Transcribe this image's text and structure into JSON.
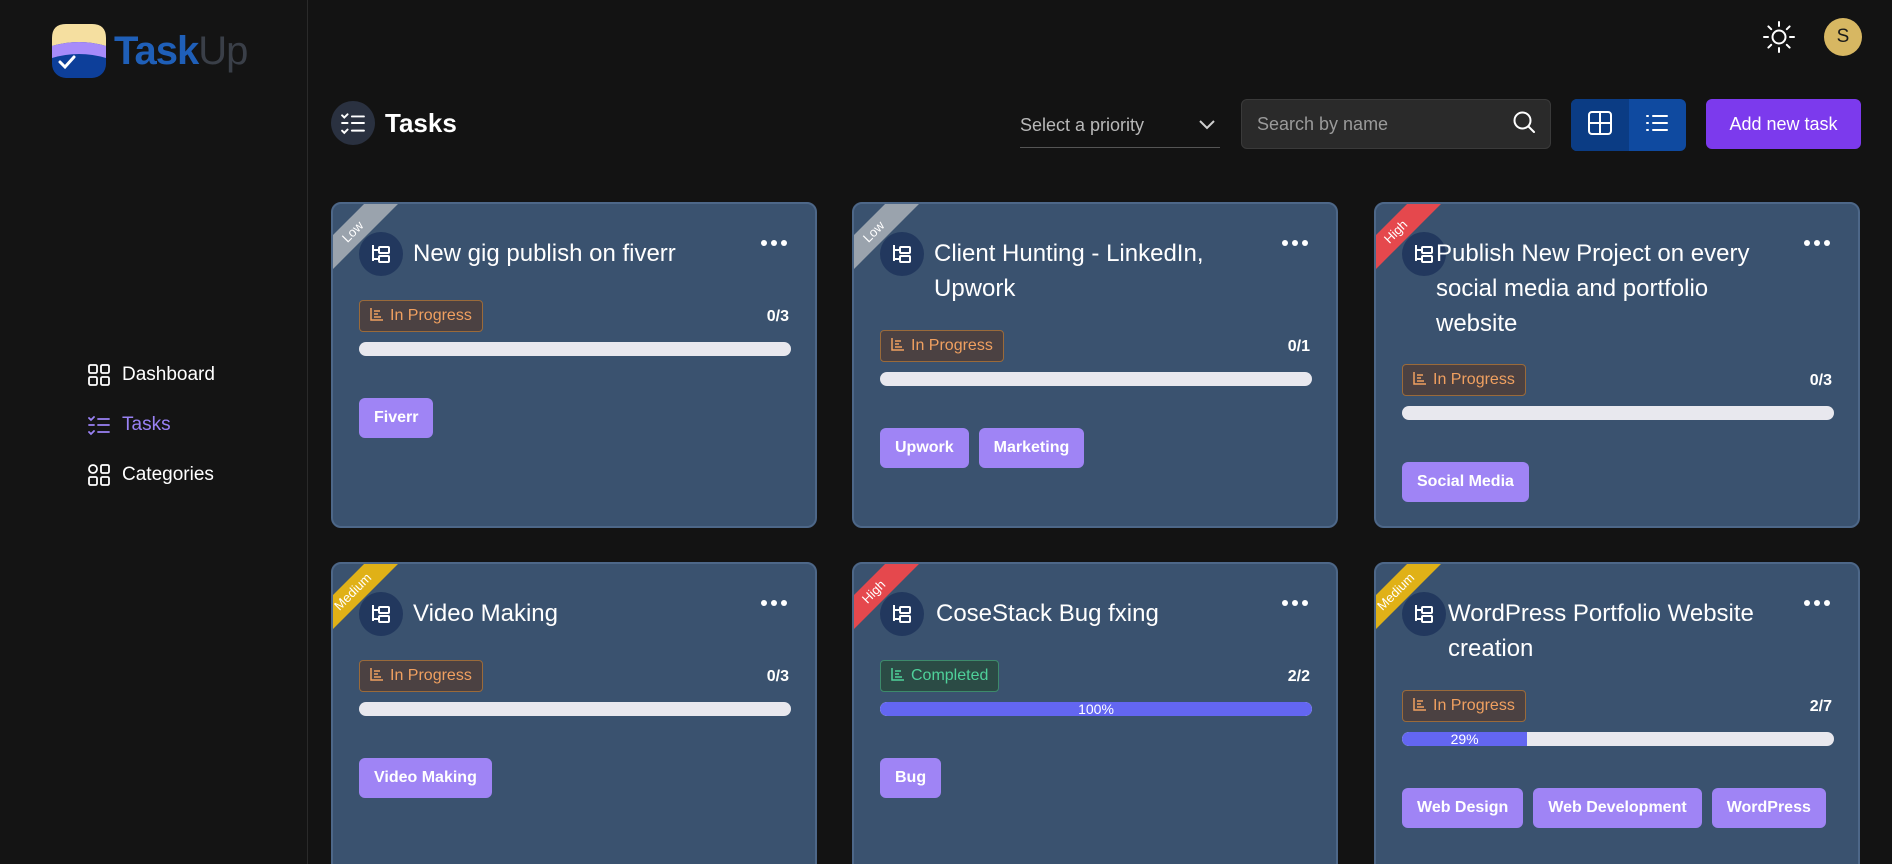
{
  "app": {
    "logo_task": "Task",
    "logo_up": "Up",
    "avatar_initial": "S"
  },
  "sidebar": {
    "items": [
      {
        "label": "Dashboard",
        "icon": "grid-icon",
        "active": false
      },
      {
        "label": "Tasks",
        "icon": "checklist-icon",
        "active": true
      },
      {
        "label": "Categories",
        "icon": "categories-icon",
        "active": false
      }
    ]
  },
  "header": {
    "title": "Tasks",
    "priority_placeholder": "Select a priority",
    "search_placeholder": "Search by name",
    "add_label": "Add new task"
  },
  "colors": {
    "low": "#9aa3ad",
    "medium": "#e0b117",
    "high": "#e5484d",
    "accent": "#7c3aed",
    "tag": "#9f84f5"
  },
  "tasks": [
    {
      "title": "New gig publish on fiverr",
      "priority": "Low",
      "status": "In Progress",
      "done": 0,
      "total": 3,
      "count": "0/3",
      "percent_label": "",
      "progress": 0,
      "tags": [
        "Fiverr"
      ]
    },
    {
      "title": "Client Hunting - LinkedIn, Upwork",
      "priority": "Low",
      "status": "In Progress",
      "done": 0,
      "total": 1,
      "count": "0/1",
      "percent_label": "",
      "progress": 0,
      "tags": [
        "Upwork",
        "Marketing"
      ]
    },
    {
      "title": "Publish New Project on every social media and portfolio website",
      "priority": "High",
      "status": "In Progress",
      "done": 0,
      "total": 3,
      "count": "0/3",
      "percent_label": "",
      "progress": 0,
      "tags": [
        "Social Media"
      ]
    },
    {
      "title": "Video Making",
      "priority": "Medium",
      "status": "In Progress",
      "done": 0,
      "total": 3,
      "count": "0/3",
      "percent_label": "",
      "progress": 0,
      "tags": [
        "Video Making"
      ]
    },
    {
      "title": "CoseStack Bug fxing",
      "priority": "High",
      "status": "Completed",
      "done": 2,
      "total": 2,
      "count": "2/2",
      "percent_label": "100%",
      "progress": 1,
      "tags": [
        "Bug"
      ]
    },
    {
      "title": "WordPress Portfolio Website creation",
      "priority": "Medium",
      "status": "In Progress",
      "done": 2,
      "total": 7,
      "count": "2/7",
      "percent_label": "29%",
      "progress": 0.29,
      "tags": [
        "Web Design",
        "Web Development",
        "WordPress"
      ]
    }
  ]
}
